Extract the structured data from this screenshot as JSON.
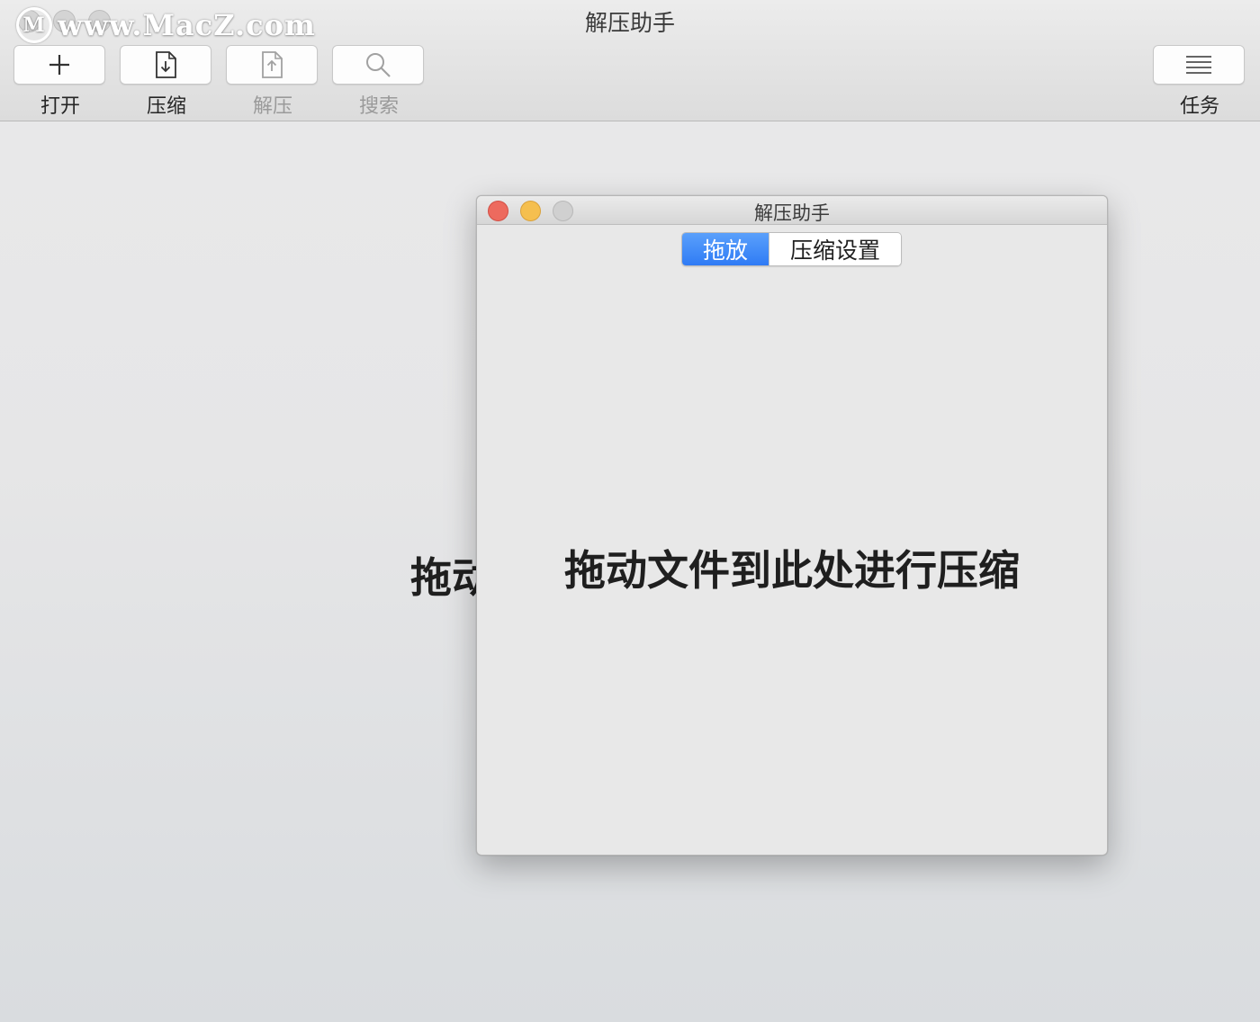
{
  "watermark": {
    "logo_letter": "M",
    "text": "www.MacZ.com"
  },
  "main_window": {
    "title": "解压助手",
    "toolbar": {
      "open_label": "打开",
      "compress_label": "压缩",
      "extract_label": "解压",
      "search_label": "搜索",
      "tasks_label": "任务"
    },
    "background_hint": "拖动"
  },
  "dialog": {
    "title": "解压助手",
    "tabs": [
      {
        "label": "拖放",
        "active": true
      },
      {
        "label": "压缩设置",
        "active": false
      }
    ],
    "drop_hint": "拖动文件到此处进行压缩"
  },
  "colors": {
    "accent": "#2f7bf5",
    "close": "#ed6a5e",
    "minimize": "#f5bf4f",
    "disabled_text": "#9a9a9a"
  },
  "icons": {
    "open": "plus-icon",
    "compress": "file-download-icon",
    "extract": "file-upload-icon",
    "search": "magnifier-icon",
    "tasks": "list-icon"
  }
}
